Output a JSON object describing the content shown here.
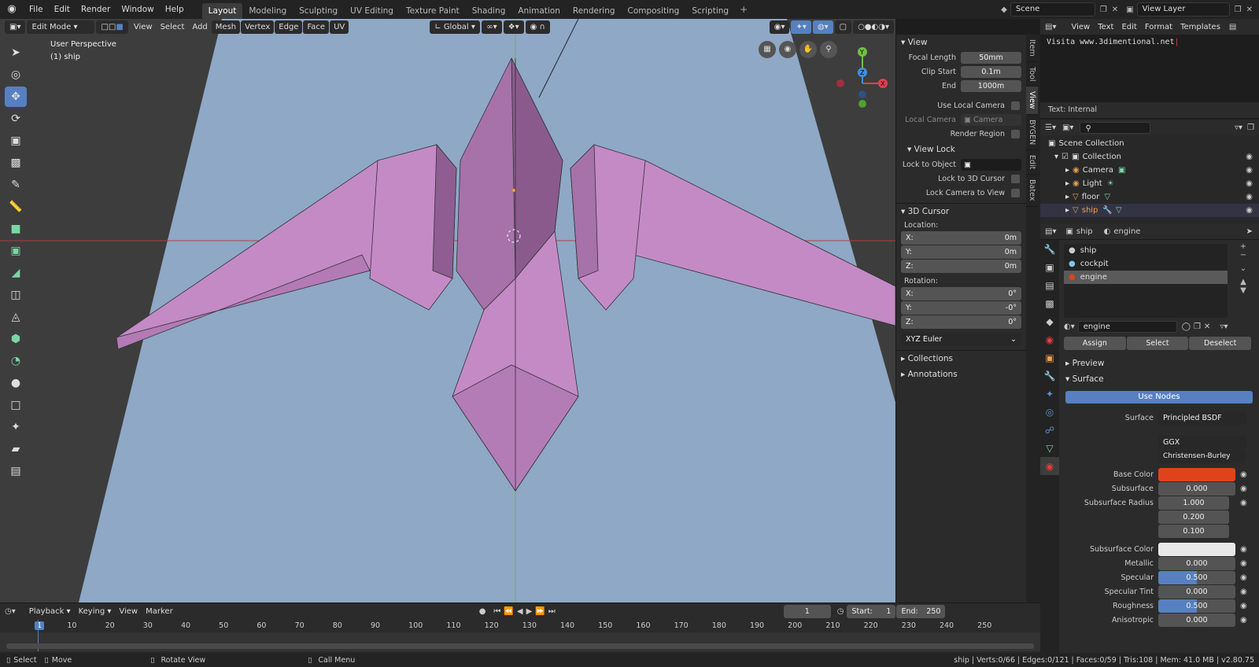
{
  "menubar": {
    "items": [
      "File",
      "Edit",
      "Render",
      "Window",
      "Help"
    ],
    "workspaces": [
      "Layout",
      "Modeling",
      "Sculpting",
      "UV Editing",
      "Texture Paint",
      "Shading",
      "Animation",
      "Rendering",
      "Compositing",
      "Scripting"
    ],
    "active_workspace": "Layout",
    "scene": "Scene",
    "view_layer": "View Layer"
  },
  "viewport_header": {
    "mode": "Edit Mode",
    "menus": [
      "View",
      "Select",
      "Add",
      "Mesh",
      "Vertex",
      "Edge",
      "Face",
      "UV"
    ],
    "orientation": "Global"
  },
  "viewport": {
    "perspective": "User Perspective",
    "object": "(1) ship"
  },
  "npanel": {
    "tabs": [
      "Item",
      "Tool",
      "View",
      "BYGEN",
      "Edit",
      "Batex"
    ],
    "active_tab": "View",
    "view_section": "View",
    "focal_length_label": "Focal Length",
    "focal_length": "50mm",
    "clip_start_label": "Clip Start",
    "clip_start": "0.1m",
    "end_label": "End",
    "clip_end": "1000m",
    "use_local_camera": "Use Local Camera",
    "local_camera_label": "Local Camera",
    "local_camera": "Camera",
    "render_region": "Render Region",
    "view_lock": "View Lock",
    "lock_to_object": "Lock to Object",
    "lock_to_3d_cursor": "Lock to 3D Cursor",
    "lock_camera_to_view": "Lock Camera to View",
    "cursor_section": "3D Cursor",
    "location_label": "Location:",
    "loc": [
      {
        "axis": "X:",
        "val": "0m"
      },
      {
        "axis": "Y:",
        "val": "0m"
      },
      {
        "axis": "Z:",
        "val": "0m"
      }
    ],
    "rotation_label": "Rotation:",
    "rot": [
      {
        "axis": "X:",
        "val": "0°"
      },
      {
        "axis": "Y:",
        "val": "-0°"
      },
      {
        "axis": "Z:",
        "val": "0°"
      }
    ],
    "rotation_mode": "XYZ Euler",
    "collections": "Collections",
    "annotations": "Annotations"
  },
  "text_editor": {
    "menus": [
      "View",
      "Text",
      "Edit",
      "Format",
      "Templates"
    ],
    "content": "Visita www.3dimentional.net",
    "footer": "Text: Internal"
  },
  "outliner": {
    "scene_collection": "Scene Collection",
    "collection": "Collection",
    "items": [
      "Camera",
      "Light",
      "floor",
      "ship"
    ],
    "active_item": "ship"
  },
  "properties": {
    "object": "ship",
    "material": "engine",
    "slots": [
      "ship",
      "cockpit",
      "engine"
    ],
    "active_slot": "engine",
    "material_name": "engine",
    "assign": "Assign",
    "select": "Select",
    "deselect": "Deselect",
    "preview": "Preview",
    "surface_section": "Surface",
    "use_nodes": "Use Nodes",
    "surface_label": "Surface",
    "surface_shader": "Principled BSDF",
    "distribution": "GGX",
    "subsurface_method": "Christensen-Burley",
    "base_color_label": "Base Color",
    "base_color": "#e0431b",
    "subsurface_label": "Subsurface",
    "subsurface": "0.000",
    "subsurface_radius_label": "Subsurface Radius",
    "subsurface_radius": [
      "1.000",
      "0.200",
      "0.100"
    ],
    "subsurface_color_label": "Subsurface Color",
    "subsurface_color": "#e8e8e8",
    "metallic_label": "Metallic",
    "metallic": "0.000",
    "specular_label": "Specular",
    "specular": "0.500",
    "specular_tint_label": "Specular Tint",
    "specular_tint": "0.000",
    "roughness_label": "Roughness",
    "roughness": "0.500",
    "anisotropic_label": "Anisotropic",
    "anisotropic": "0.000"
  },
  "timeline": {
    "menus": [
      "Playback",
      "Keying",
      "View",
      "Marker"
    ],
    "current_frame": "1",
    "start_label": "Start:",
    "start": "1",
    "end_label": "End:",
    "end": "250",
    "ticks": [
      "1",
      "10",
      "20",
      "30",
      "40",
      "50",
      "60",
      "70",
      "80",
      "90",
      "100",
      "110",
      "120",
      "130",
      "140",
      "150",
      "160",
      "170",
      "180",
      "190",
      "200",
      "210",
      "220",
      "230",
      "240",
      "250"
    ]
  },
  "statusbar": {
    "select": "Select",
    "move": "Move",
    "rotate_view": "Rotate View",
    "call_menu": "Call Menu",
    "stats": "ship | Verts:0/66 | Edges:0/121 | Faces:0/59 | Tris:108 | Mem: 41.0 MB | v2.80.75"
  },
  "colors": {
    "accent": "#5680c2",
    "mesh": "#c08ac2",
    "floor": "#8ea8c6"
  }
}
